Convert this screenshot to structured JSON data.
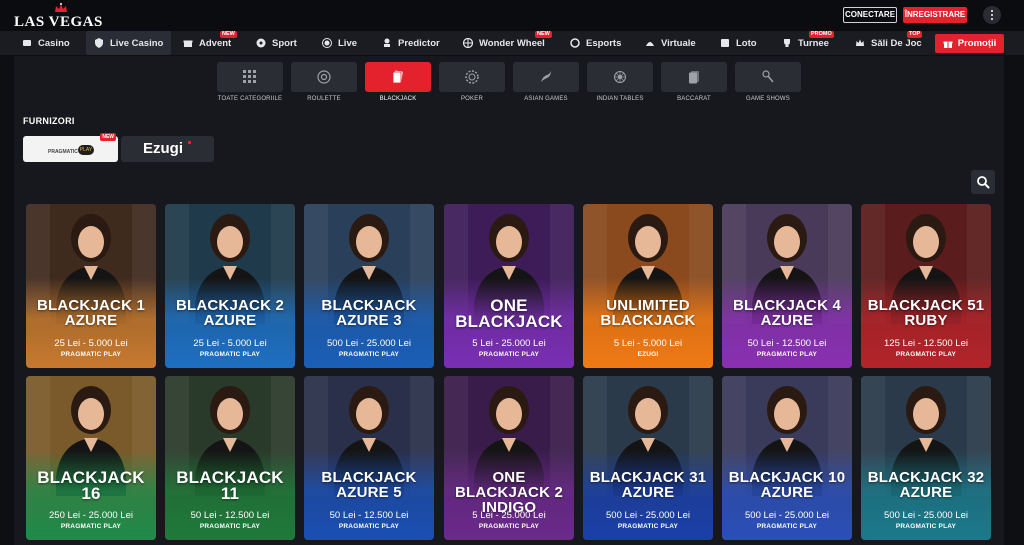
{
  "header": {
    "logo_text": "LAS VEGAS",
    "login_label": "CONECTARE",
    "register_label": "ÎNREGISTRARE",
    "menu_icon": "more-vertical-icon"
  },
  "nav": {
    "items": [
      {
        "label": "Casino",
        "icon": "casino-icon"
      },
      {
        "label": "Live Casino",
        "icon": "shield-icon"
      },
      {
        "label": "Advent",
        "icon": "gift-icon",
        "badge": "NEW"
      },
      {
        "label": "Sport",
        "icon": "soccer-ball-icon"
      },
      {
        "label": "Live",
        "icon": "live-icon"
      },
      {
        "label": "Predictor",
        "icon": "predictor-icon"
      },
      {
        "label": "Wonder Wheel",
        "icon": "wheel-icon",
        "badge": "NEW"
      },
      {
        "label": "Esports",
        "icon": "esports-icon"
      },
      {
        "label": "Virtuale",
        "icon": "virtual-icon"
      },
      {
        "label": "Loto",
        "icon": "lotto-icon"
      },
      {
        "label": "Turnee",
        "icon": "trophy-icon",
        "badge": "PROMO"
      },
      {
        "label": "Săli De Joc",
        "icon": "crown-icon",
        "badge": "TOP"
      },
      {
        "label": "Promoții",
        "icon": "gift-icon"
      }
    ]
  },
  "categories": [
    {
      "label": "TOATE CATEGORIILE",
      "icon": "grid-icon"
    },
    {
      "label": "ROULETTE",
      "icon": "roulette-icon"
    },
    {
      "label": "BLACKJACK",
      "icon": "cards-icon",
      "active": true
    },
    {
      "label": "POKER",
      "icon": "poker-chip-icon"
    },
    {
      "label": "ASIAN GAMES",
      "icon": "dragon-icon"
    },
    {
      "label": "INDIAN TABLES",
      "icon": "mandala-icon"
    },
    {
      "label": "BACCARAT",
      "icon": "cards-stack-icon"
    },
    {
      "label": "GAME SHOWS",
      "icon": "microphone-icon"
    }
  ],
  "providers": {
    "title": "FURNIZORI",
    "items": [
      {
        "name": "PRAGMATIC PLAY",
        "badge": "NEW",
        "play": "PLAY"
      },
      {
        "name": "Ezugi"
      }
    ]
  },
  "search_icon": "search-icon",
  "games": [
    {
      "title": "BLACKJACK 1 AZURE",
      "limits": "25 Lei - 5.000 Lei",
      "provider": "PRAGMATIC PLAY",
      "bg": "#3f2a1e",
      "accent": "#c77a2f"
    },
    {
      "title": "BLACKJACK 2 AZURE",
      "limits": "25 Lei - 5.000 Lei",
      "provider": "PRAGMATIC PLAY",
      "bg": "#1f3a4a",
      "accent": "#1e6fc2"
    },
    {
      "title": "BLACKJACK AZURE 3",
      "limits": "500 Lei - 25.000 Lei",
      "provider": "PRAGMATIC PLAY",
      "bg": "#2a3f5a",
      "accent": "#1a5fb8"
    },
    {
      "title": "ONE BLACKJACK",
      "limits": "5 Lei - 25.000 Lei",
      "provider": "PRAGMATIC PLAY",
      "bg": "#3d1c58",
      "accent": "#7a2fb3"
    },
    {
      "title": "UNLIMITED BLACKJACK",
      "limits": "5 Lei - 5.000 Lei",
      "provider": "EZUGI",
      "bg": "#8a4a1e",
      "accent": "#f07a14"
    },
    {
      "title": "BLACKJACK 4 AZURE",
      "limits": "50 Lei - 12.500 Lei",
      "provider": "PRAGMATIC PLAY",
      "bg": "#4a3a5a",
      "accent": "#8a2fb3"
    },
    {
      "title": "BLACKJACK 51 RUBY",
      "limits": "125 Lei - 12.500 Lei",
      "provider": "PRAGMATIC PLAY",
      "bg": "#5a1c1c",
      "accent": "#b3242a"
    },
    {
      "title": "BLACKJACK 16",
      "limits": "250 Lei - 25.000 Lei",
      "provider": "PRAGMATIC PLAY",
      "bg": "#7a5a2a",
      "accent": "#1f8a4a"
    },
    {
      "title": "BLACKJACK 11",
      "limits": "50 Lei - 12.500 Lei",
      "provider": "PRAGMATIC PLAY",
      "bg": "#2a3a2a",
      "accent": "#1f7a3a"
    },
    {
      "title": "BLACKJACK AZURE 5",
      "limits": "50 Lei - 12.500 Lei",
      "provider": "PRAGMATIC PLAY",
      "bg": "#2a2f4a",
      "accent": "#1a4fb3"
    },
    {
      "title": "ONE BLACKJACK 2 INDIGO",
      "limits": "5 Lei - 25.000 Lei",
      "provider": "PRAGMATIC PLAY",
      "bg": "#3a1c4a",
      "accent": "#6a2a8a"
    },
    {
      "title": "BLACKJACK 31 AZURE",
      "limits": "500 Lei - 25.000 Lei",
      "provider": "PRAGMATIC PLAY",
      "bg": "#2a3a4a",
      "accent": "#1a3fa8"
    },
    {
      "title": "BLACKJACK 10 AZURE",
      "limits": "500 Lei - 25.000 Lei",
      "provider": "PRAGMATIC PLAY",
      "bg": "#3a3a5a",
      "accent": "#2a4fb8"
    },
    {
      "title": "BLACKJACK 32 AZURE",
      "limits": "500 Lei - 25.000 Lei",
      "provider": "PRAGMATIC PLAY",
      "bg": "#2a3a4a",
      "accent": "#1a7a8a"
    }
  ]
}
